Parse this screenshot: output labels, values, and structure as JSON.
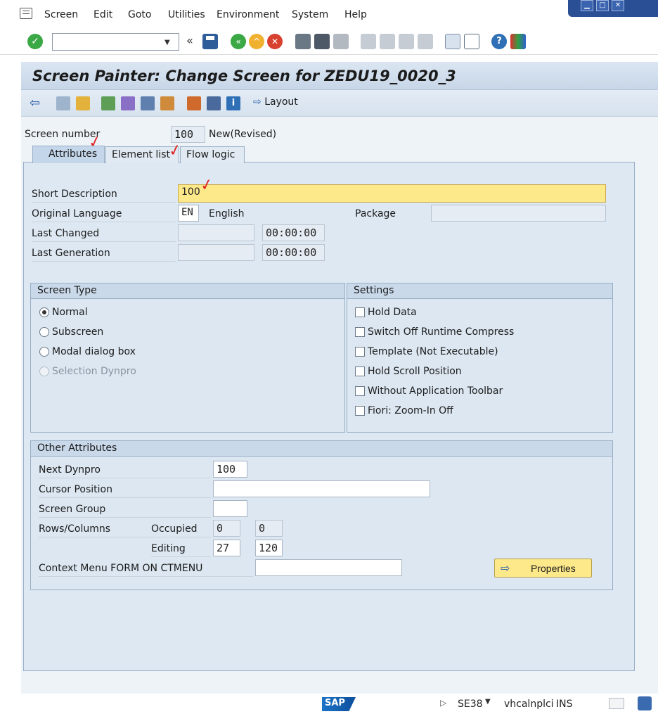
{
  "menubar": {
    "items": [
      "Screen",
      "Edit",
      "Goto",
      "Utilities",
      "Environment",
      "System",
      "Help"
    ]
  },
  "toolbar": {
    "command_value": "",
    "icons": [
      "enter-icon",
      "save-icon",
      "back-icon",
      "exit-icon",
      "cancel-icon",
      "print-icon",
      "find-icon",
      "find-next-icon",
      "first-page-icon",
      "prev-page-icon",
      "next-page-icon",
      "last-page-icon",
      "create-session-icon",
      "shortcut-icon",
      "help-icon",
      "customize-icon"
    ]
  },
  "title": "Screen Painter: Change Screen for ZEDU19_0020_3",
  "app_toolbar": {
    "layout_label": "Layout"
  },
  "header": {
    "screen_number_label": "Screen number",
    "screen_number": "100",
    "status": "New(Revised)"
  },
  "tabs": [
    "Attributes",
    "Element list",
    "Flow logic"
  ],
  "attributes": {
    "short_description_label": "Short Description",
    "short_description": "100",
    "original_language_label": "Original Language",
    "language_code": "EN",
    "language_name": "English",
    "package_label": "Package",
    "package": "",
    "last_changed_label": "Last Changed",
    "last_changed_date": "",
    "last_changed_time": "00:00:00",
    "last_generation_label": "Last Generation",
    "last_generation_date": "",
    "last_generation_time": "00:00:00"
  },
  "screen_type": {
    "title": "Screen Type",
    "options": [
      "Normal",
      "Subscreen",
      "Modal dialog box",
      "Selection Dynpro"
    ],
    "selected": "Normal"
  },
  "settings": {
    "title": "Settings",
    "options": [
      "Hold Data",
      "Switch Off Runtime Compress",
      "Template (Not Executable)",
      "Hold Scroll Position",
      "Without Application Toolbar",
      "Fiori: Zoom-In Off"
    ]
  },
  "other_attributes": {
    "title": "Other Attributes",
    "next_dynpro_label": "Next Dynpro",
    "next_dynpro": "100",
    "cursor_position_label": "Cursor Position",
    "cursor_position": "",
    "screen_group_label": "Screen Group",
    "screen_group": "",
    "rows_columns_label": "Rows/Columns",
    "occupied_label": "Occupied",
    "occupied_rows": "0",
    "occupied_cols": "0",
    "editing_label": "Editing",
    "editing_rows": "27",
    "editing_cols": "120",
    "context_menu_label": "Context Menu FORM ON CTMENU",
    "context_menu": "",
    "properties_label": "Properties"
  },
  "statusbar": {
    "transaction": "SE38",
    "server": "vhcalnplci",
    "mode": "INS"
  },
  "colors": {
    "accent": "#c4d6ea",
    "required_field": "#fde98a",
    "annotation": "#e02020"
  }
}
